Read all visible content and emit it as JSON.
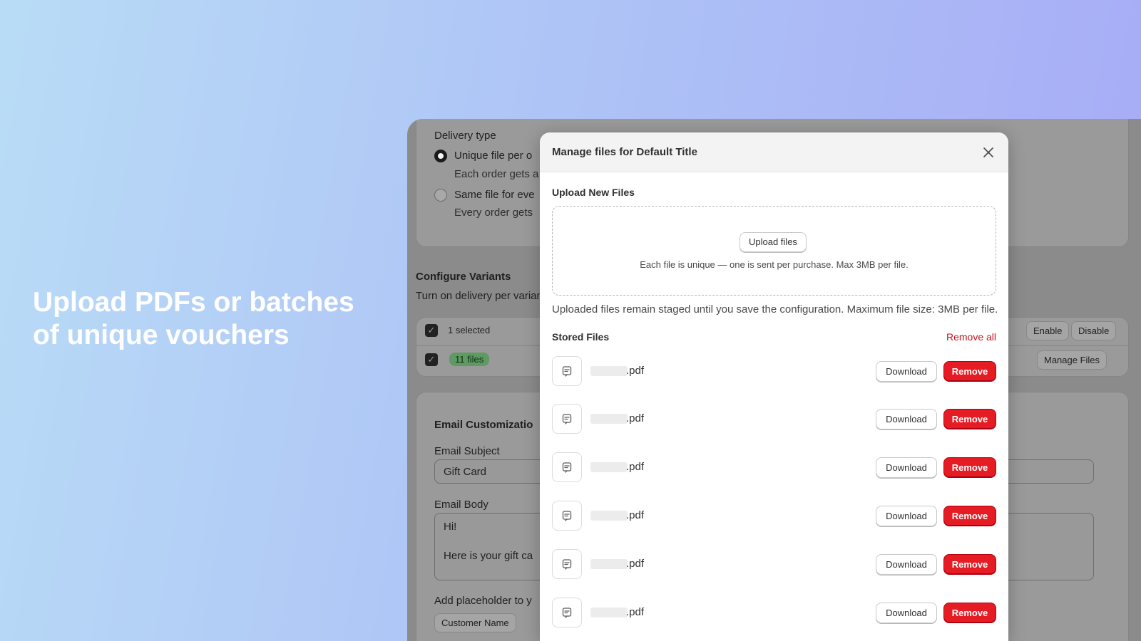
{
  "headline": {
    "line1": "Upload PDFs or batches",
    "line2": "of unique vouchers"
  },
  "background": {
    "delivery_type_label": "Delivery type",
    "option_unique": "Unique file per o",
    "option_unique_desc": "Each order gets a",
    "option_same": "Same file for eve",
    "option_same_desc": "Every order gets",
    "configure_title": "Configure Variants",
    "configure_desc": "Turn on delivery per varian",
    "selected_label": "1 selected",
    "enable_label": "Enable",
    "disable_label": "Disable",
    "files_badge": "11 files",
    "manage_files_label": "Manage Files",
    "email_title": "Email Customizatio",
    "email_subject_label": "Email Subject",
    "email_subject_value": "Gift Card",
    "email_body_label": "Email Body",
    "email_body_line1": "Hi!",
    "email_body_line2": "Here is your gift ca",
    "placeholder_label": "Add placeholder to y",
    "customer_name_label": "Customer Name"
  },
  "modal": {
    "title": "Manage files for Default Title",
    "upload_section": "Upload New Files",
    "upload_button": "Upload files",
    "upload_hint": "Each file is unique — one is sent per purchase. Max 3MB per file.",
    "staged_note": "Uploaded files remain staged until you save the configuration. Maximum file size: 3MB per file.",
    "stored_section": "Stored Files",
    "remove_all": "Remove all",
    "download_label": "Download",
    "remove_label": "Remove",
    "files": [
      {
        "name": ".pdf"
      },
      {
        "name": ".pdf"
      },
      {
        "name": ".pdf"
      },
      {
        "name": ".pdf"
      },
      {
        "name": ".pdf"
      },
      {
        "name": ".pdf"
      }
    ]
  },
  "colors": {
    "danger": "#e51c23",
    "badge_green": "#5f9a63",
    "gradient_start": "#b9dcf6",
    "gradient_end": "#a7aaf6"
  }
}
